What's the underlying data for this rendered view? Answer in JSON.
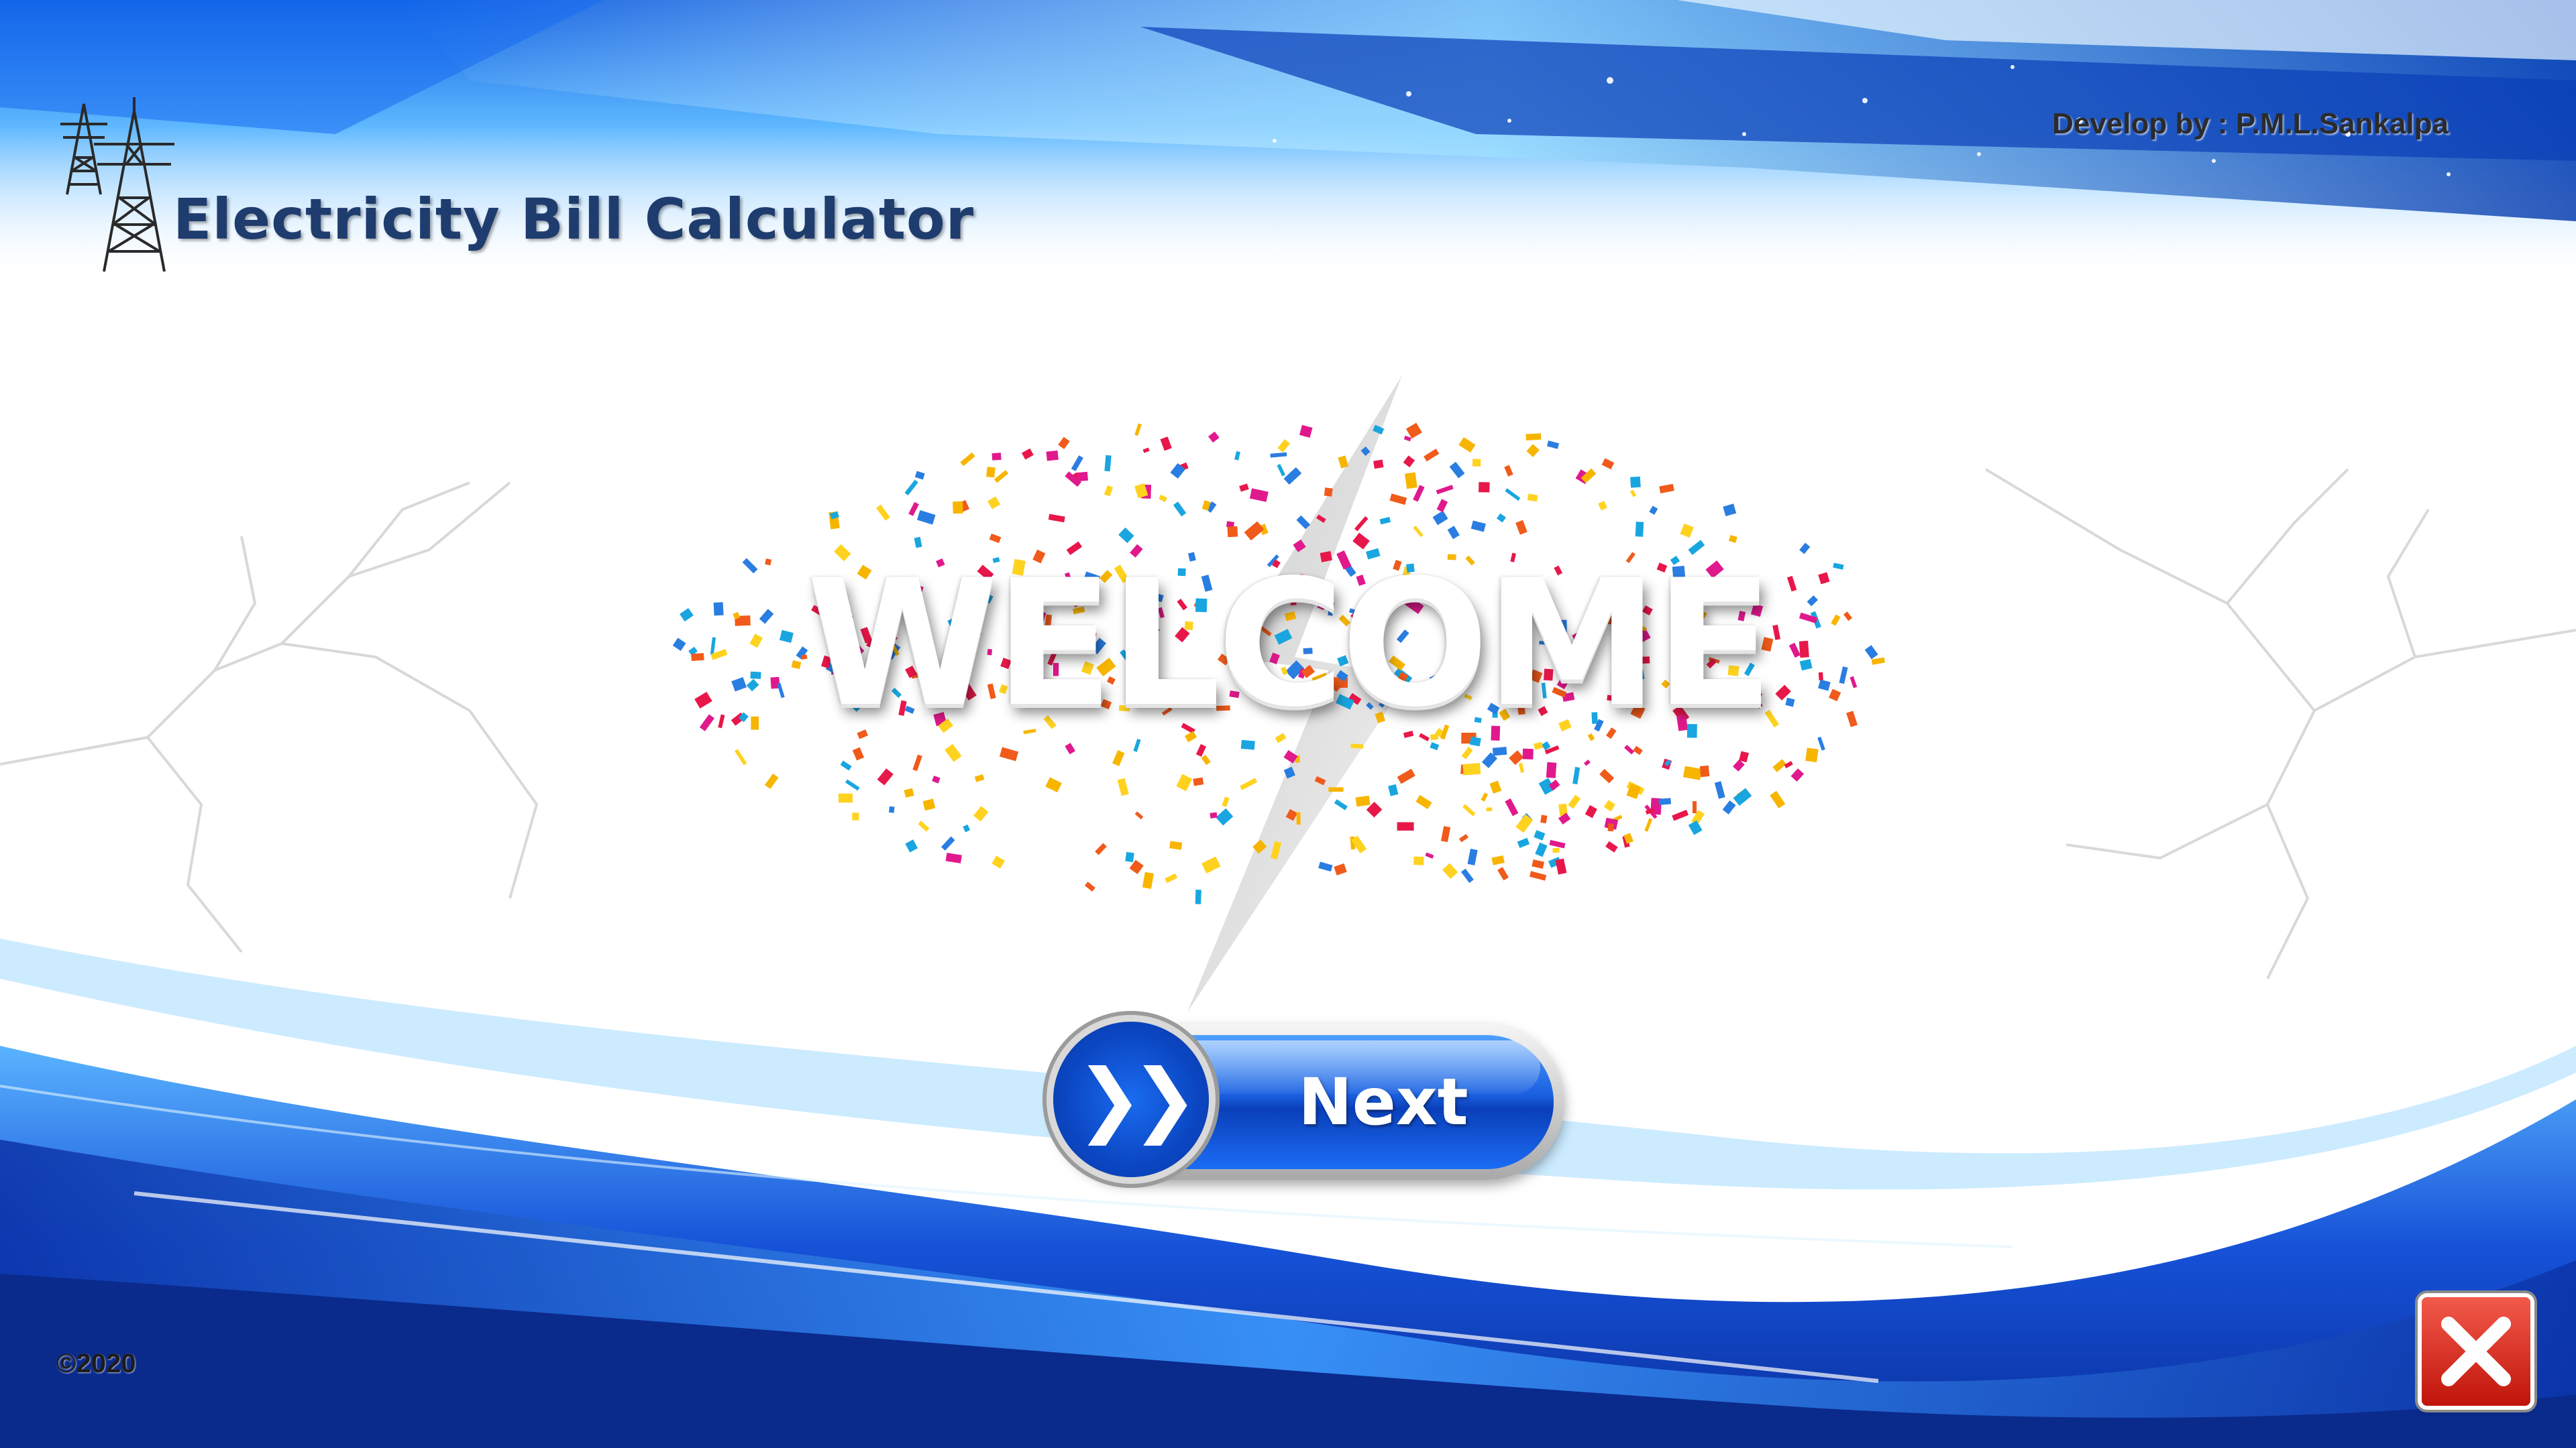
{
  "header": {
    "title": "Electricity Bill Calculator",
    "developer": "Develop by : P.M.L.Sankalpa",
    "logo_icon": "power-tower-icon"
  },
  "main": {
    "welcome_text": "WELCOME",
    "next_button": {
      "label": "Next",
      "icon": "double-chevron-right-icon",
      "icon_glyph": "❯❯"
    }
  },
  "footer": {
    "copyright": "©2020",
    "close_icon": "close-icon"
  },
  "colors": {
    "title": "#1f3c6e",
    "accent_blue": "#1a5fe0",
    "close_red": "#c0140a"
  }
}
